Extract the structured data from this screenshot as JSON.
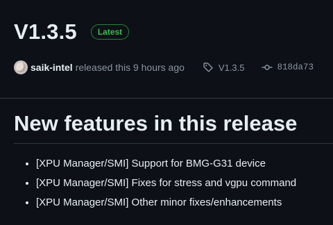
{
  "release": {
    "version": "V1.3.5",
    "badge": "Latest",
    "author": "saik-intel",
    "released_text": "released this 9 hours ago",
    "tag": "V1.3.5",
    "commit": "818da73"
  },
  "section": {
    "heading": "New features in this release",
    "items": [
      "[XPU Manager/SMI] Support for BMG-G31 device",
      "[XPU Manager/SMI] Fixes for stress and vgpu command",
      "[XPU Manager/SMI] Other minor fixes/enhancements"
    ]
  },
  "icons": {
    "tag": "tag-icon",
    "commit": "git-commit-icon",
    "avatar": "user-avatar"
  },
  "colors": {
    "background": "#0d1117",
    "badge_green": "#3fb950",
    "muted_text": "#8b949e"
  }
}
